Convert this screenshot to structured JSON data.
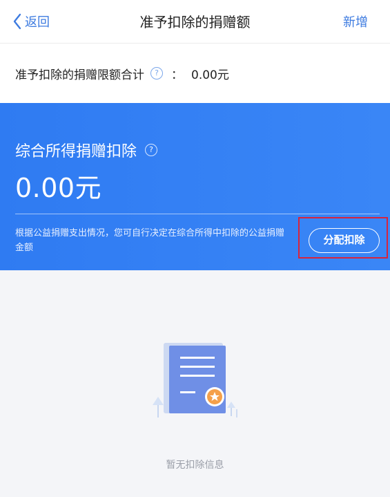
{
  "nav": {
    "back_label": "返回",
    "title": "准予扣除的捐赠额",
    "action_label": "新增"
  },
  "limit": {
    "label": "准予扣除的捐赠限额合计",
    "colon": "：",
    "value": "0.00元"
  },
  "card": {
    "title": "综合所得捐赠扣除",
    "amount": "0.00元",
    "note": "根据公益捐赠支出情况，您可自行决定在综合所得中扣除的公益捐赠金额",
    "button_label": "分配扣除"
  },
  "empty": {
    "text": "暂无扣除信息"
  },
  "colors": {
    "accent": "#3d7be0",
    "card_gradient_start": "#2f7bf2",
    "highlight_border": "#d8243c"
  }
}
